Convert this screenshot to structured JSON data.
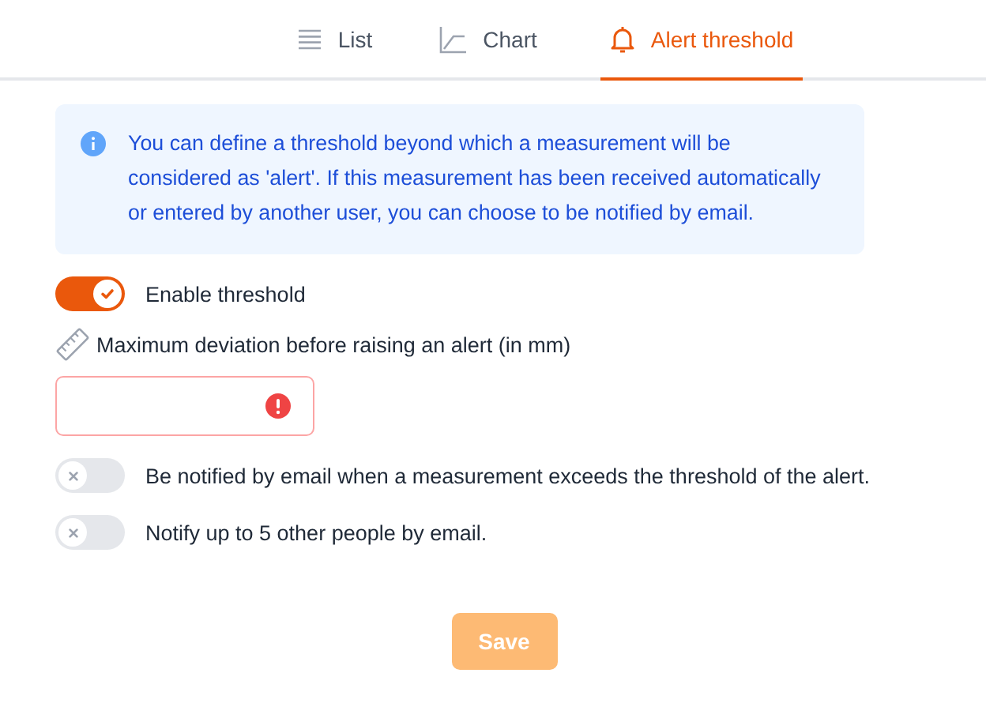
{
  "tabs": [
    {
      "label": "List",
      "kind": "list",
      "selected": false
    },
    {
      "label": "Chart",
      "kind": "chart",
      "selected": false
    },
    {
      "label": "Alert threshold",
      "kind": "alert",
      "selected": true
    }
  ],
  "info": {
    "text": "You can define a threshold beyond which a measurement will be considered as 'alert'. If this measurement has been received automatically or entered by another user, you can choose to be notified by email."
  },
  "enable_toggle": {
    "label": "Enable threshold",
    "on": true
  },
  "deviation_field": {
    "label": "Maximum deviation before raising an alert (in mm)",
    "error": true
  },
  "notify_toggles": [
    {
      "label": "Be notified by email when a measurement exceeds the threshold of the alert.",
      "on": false
    },
    {
      "label": "Notify up to 5 other people by email.",
      "on": false
    }
  ],
  "save_button": {
    "label": "Save",
    "disabled": true
  }
}
